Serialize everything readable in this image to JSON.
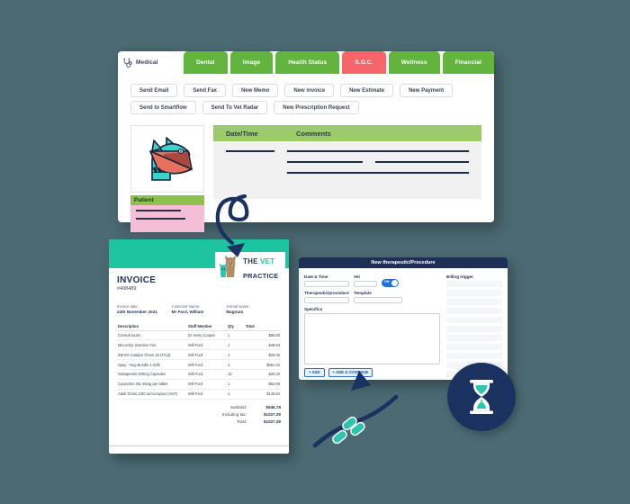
{
  "background_color": "#4c6a73",
  "medical_window": {
    "tabs": [
      {
        "label": "Medical",
        "state": "active",
        "icon": "stethoscope-icon",
        "color": "#ffffff"
      },
      {
        "label": "Dental",
        "state": "inactive",
        "color": "#62b43f"
      },
      {
        "label": "Image",
        "state": "inactive",
        "color": "#62b43f"
      },
      {
        "label": "Health Status",
        "state": "inactive",
        "color": "#62b43f"
      },
      {
        "label": "S.O.C.",
        "state": "inactive",
        "color": "#f4666c"
      },
      {
        "label": "Wellness",
        "state": "inactive",
        "color": "#62b43f"
      },
      {
        "label": "Financial",
        "state": "inactive",
        "color": "#62b43f"
      }
    ],
    "action_buttons_row1": [
      "Send Email",
      "Send Fax",
      "New Memo",
      "New invoice",
      "New Estimate",
      "New Payment"
    ],
    "action_buttons_row2": [
      "Send to Smartflow",
      "Send To Vet Radar",
      "New Prescription Request"
    ],
    "patient_panel": {
      "title": "Patient",
      "photo_icon": "cat-with-cone-illustration",
      "header_color": "#8cc152",
      "body_color": "#f6bed6"
    },
    "notes_table": {
      "header_color": "#9ccb6b",
      "columns": [
        "Date/Time",
        "Comments"
      ],
      "rows": [
        {
          "date": "redacted",
          "comments": "redacted"
        },
        {
          "date": "",
          "comments": "redacted"
        },
        {
          "date": "",
          "comments": "redacted"
        }
      ]
    }
  },
  "therapeutic_window": {
    "title": "New therapeutic/Procedure",
    "title_color": "#1f3057",
    "fields": [
      {
        "label": "Date & Time",
        "value": ""
      },
      {
        "label": "Vet",
        "value": ""
      },
      {
        "label": "Therapeutic/procedure",
        "value": ""
      },
      {
        "label": "Template",
        "value": ""
      },
      {
        "label": "Specifics",
        "value": ""
      }
    ],
    "toggle": {
      "label": "ON",
      "state": "on",
      "color": "#1e73d8"
    },
    "buttons": [
      "+ ADD",
      "+ ADD & CONTINUE"
    ],
    "billing_panel": {
      "label": "Billing trigger",
      "row_count": 12
    }
  },
  "invoice": {
    "brand": {
      "line1_a": "THE ",
      "line1_b": "VET",
      "line2": "PRACTICE",
      "accent": "#1ec3a0",
      "icon": "dog-and-cat-logo"
    },
    "title": "INVOICE",
    "number": "#408489",
    "meta": [
      {
        "label": "Invoice date:",
        "value": "24th November 2021"
      },
      {
        "label": "Customer Name:",
        "value": "Mr Ford, William"
      },
      {
        "label": "Animal Name:",
        "value": "Magnum"
      }
    ],
    "columns": [
      "Description",
      "Staff Member",
      "Qty",
      "Total"
    ],
    "line_items": [
      {
        "description": "Consult exam",
        "staff": "Dr Harry Cooper",
        "qty": "1",
        "total": "$86.80"
      },
      {
        "description": "Microchip Insertion Fee",
        "staff": "Will Ford",
        "qty": "1",
        "total": "$48.83"
      },
      {
        "description": "IDEXX Catalyst Chem 15 (FA(3)",
        "staff": "Will Ford",
        "qty": "1",
        "total": "$29.05"
      },
      {
        "description": "Spay - Dog Bundle 1-22lb",
        "staff": "Will Ford",
        "qty": "1",
        "total": "$651.02"
      },
      {
        "description": "Gabapentin 300mg Capsules",
        "staff": "Will Ford",
        "qty": "10",
        "total": "$29.30"
      },
      {
        "description": "Carprofen 25c 25mg per tablet",
        "staff": "Will Ford",
        "qty": "1",
        "total": "$52.90"
      },
      {
        "description": "Adult Chem,CBC w/Acciuplus (ANT)",
        "staff": "Will Ford",
        "qty": "1",
        "total": "$149.84"
      }
    ],
    "totals": [
      {
        "label": "Subtotal:",
        "value": "$946.78"
      },
      {
        "label": "Including tax:",
        "value": "$1027.29"
      },
      {
        "label": "Total:",
        "value": "$1027.29"
      }
    ]
  },
  "decorations": {
    "hourglass_badge": {
      "icon": "hourglass-icon",
      "circle_color": "#1b3160",
      "sand_color": "#2ec4b0"
    },
    "pills": {
      "icon": "capsule-pills-icon",
      "color": "#2ec4b0",
      "count": 3
    },
    "arrows": [
      {
        "name": "arrow-to-invoice"
      },
      {
        "name": "arrow-to-therapeutic-form"
      }
    ]
  }
}
